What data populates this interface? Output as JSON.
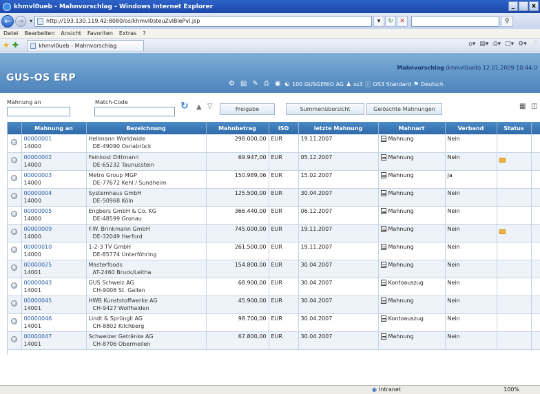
{
  "window": {
    "title": "khmvl0ueb - Mahnvorschlag - Windows Internet Explorer",
    "min_label": "_",
    "max_label": " ",
    "close_label": "x"
  },
  "address": {
    "url": "http://193.130.119.42:8080/os/khmvl0steuZvlBlePvl.jsp"
  },
  "menu": {
    "items": [
      "Datei",
      "Bearbeiten",
      "Ansicht",
      "Favoriten",
      "Extras",
      "?"
    ]
  },
  "favbar": {
    "tab_label": "khmvl0ueb - Mahnvorschlag"
  },
  "app": {
    "brand": "GUS-OS ERP",
    "page_title": "Mahnvorschlag",
    "page_meta": "(khmvl0ueb) 12.01.2009 10:44:0",
    "company": "100 GUSGENIO AG",
    "user": "ss3",
    "profile": "OS3 Standard",
    "language": "Deutsch"
  },
  "filters": {
    "mahnung_an_label": "Mahnung an",
    "match_code_label": "Match-Code",
    "freigabe_label": "Freigabe",
    "summen_label": "Summenübersicht",
    "geloeschte_label": "Gelöschte Mahnungen"
  },
  "table": {
    "columns": [
      "Mahnung an",
      "Bezeichnung",
      "Mahnbetrag",
      "ISO",
      "letzte Mahnung",
      "Mahnart",
      "Verband",
      "Status"
    ],
    "rows": [
      {
        "num": "00000001",
        "sub": "14000",
        "name": "Hellmann Worldwide",
        "addr": "DE-49090 Osnabrück",
        "amount": "298.000,00",
        "iso": "EUR",
        "last": "19.11.2007",
        "mahnart": "Mahnung",
        "verband": "Nein",
        "status": ""
      },
      {
        "num": "00000002",
        "sub": "14000",
        "name": "Feinkost Dittmann",
        "addr": "DE-65232 Taunusstein",
        "amount": "69.947,00",
        "iso": "EUR",
        "last": "05.12.2007",
        "mahnart": "Mahnung",
        "verband": "Nein",
        "status": "flag"
      },
      {
        "num": "00000003",
        "sub": "14000",
        "name": "Metro Group MGP",
        "addr": "DE-77672 Kehl / Sundheim",
        "amount": "150.989,06",
        "iso": "EUR",
        "last": "15.02.2007",
        "mahnart": "Mahnung",
        "verband": "Ja",
        "status": ""
      },
      {
        "num": "00000004",
        "sub": "14000",
        "name": "Systemhaus GmbH",
        "addr": "DE-50968 Köln",
        "amount": "125.500,00",
        "iso": "EUR",
        "last": "30.04.2007",
        "mahnart": "Mahnung",
        "verband": "Nein",
        "status": ""
      },
      {
        "num": "00000005",
        "sub": "14000",
        "name": "Engbers GmbH & Co. KG",
        "addr": "DE-48599 Gronau",
        "amount": "366.440,00",
        "iso": "EUR",
        "last": "06.12.2007",
        "mahnart": "Mahnung",
        "verband": "Nein",
        "status": ""
      },
      {
        "num": "00000009",
        "sub": "14000",
        "name": "F.W. Brinkmann GmbH",
        "addr": "DE-32049 Herford",
        "amount": "745.000,00",
        "iso": "EUR",
        "last": "19.11.2007",
        "mahnart": "Mahnung",
        "verband": "Nein",
        "status": "flag"
      },
      {
        "num": "00000010",
        "sub": "14000",
        "name": "1-2-3 TV GmbH",
        "addr": "DE-85774 Unterföhring",
        "amount": "261.500,00",
        "iso": "EUR",
        "last": "19.11.2007",
        "mahnart": "Mahnung",
        "verband": "Nein",
        "status": ""
      },
      {
        "num": "00000025",
        "sub": "14001",
        "name": "Masterfoods",
        "addr": "AT-2460 Bruck/Leitha",
        "amount": "154.800,00",
        "iso": "EUR",
        "last": "30.04.2007",
        "mahnart": "Mahnung",
        "verband": "Nein",
        "status": ""
      },
      {
        "num": "00000043",
        "sub": "14001",
        "name": "GUS Schweiz AG",
        "addr": "CH-9008 St. Gallen",
        "amount": "68.900,00",
        "iso": "EUR",
        "last": "30.04.2007",
        "mahnart": "Kontoauszug",
        "verband": "Nein",
        "status": ""
      },
      {
        "num": "00000045",
        "sub": "14001",
        "name": "HWB Kunststoffwerke AG",
        "addr": "CH-9427 Wolfhalden",
        "amount": "45.900,00",
        "iso": "EUR",
        "last": "30.04.2007",
        "mahnart": "Mahnung",
        "verband": "Nein",
        "status": ""
      },
      {
        "num": "00000046",
        "sub": "14001",
        "name": "Lindt & Sprüngli AG",
        "addr": "CH-8802 Kilchberg",
        "amount": "98.700,00",
        "iso": "EUR",
        "last": "30.04.2007",
        "mahnart": "Kontoauszug",
        "verband": "Nein",
        "status": ""
      },
      {
        "num": "00000047",
        "sub": "14001",
        "name": "Schweizer Getränke AG",
        "addr": "CH-8706 Obermeilen",
        "amount": "67.800,00",
        "iso": "EUR",
        "last": "30.04.2007",
        "mahnart": "Mahnung",
        "verband": "Nein",
        "status": ""
      }
    ]
  },
  "statusbar": {
    "zone": "Intranet",
    "zoom": "100%"
  },
  "colors": {
    "title_bar": "#1b47a8",
    "app_header": "#5d93c6",
    "table_header": "#2f6aa9",
    "status_flag": "#f2b13a"
  }
}
